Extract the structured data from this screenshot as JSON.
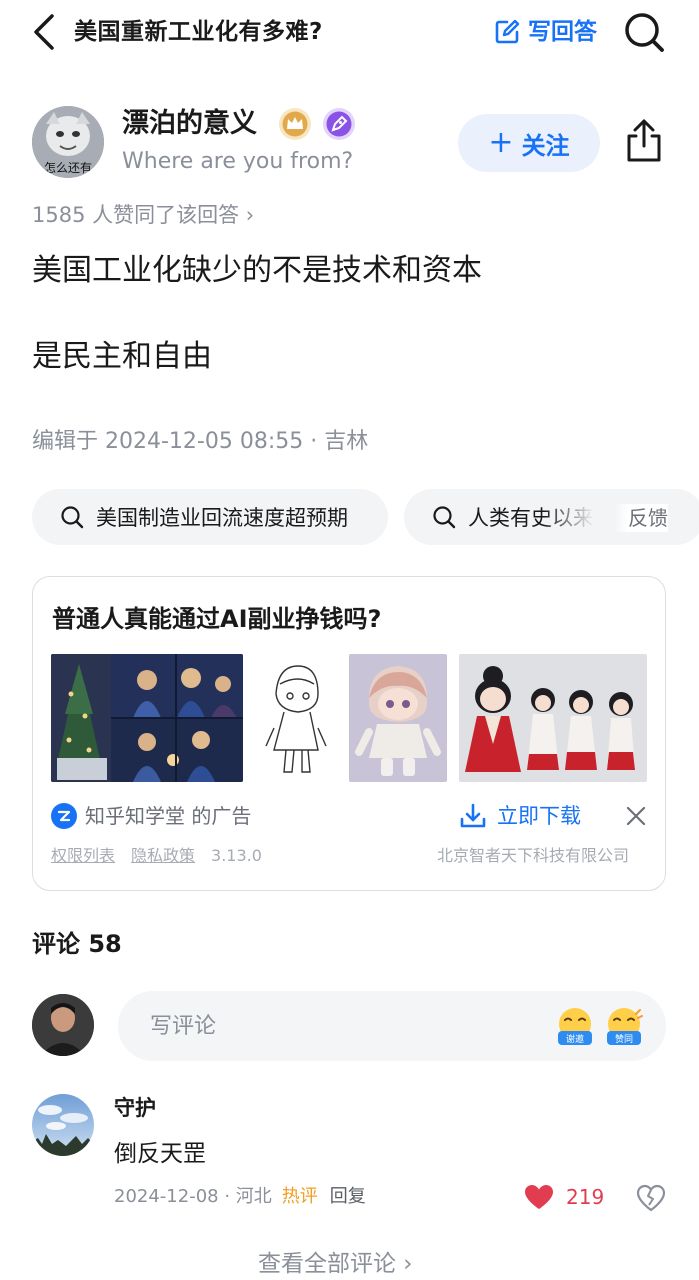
{
  "header": {
    "question_title": "美国重新工业化有多难?",
    "write_answer_label": "写回答"
  },
  "author": {
    "name": "漂泊的意义",
    "location": "Where are you from?",
    "avatar_text": "怎么还有",
    "follow_label": "关注"
  },
  "answer": {
    "agree_count_text": "1585 人赞同了该回答 ›",
    "paragraphs": [
      "美国工业化缺少的不是技术和资本",
      "是民主和自由"
    ],
    "edited_text": "编辑于 2024-12-05 08:55 · 吉林"
  },
  "related_searches": [
    {
      "label": "美国制造业回流速度超预期"
    },
    {
      "label": "人类有史以来"
    }
  ],
  "feedback_label": "反馈",
  "ad": {
    "title": "普通人真能通过AI副业挣钱吗?",
    "source": "知乎知学堂 的广告",
    "download_label": "立即下载",
    "permissions_label": "权限列表",
    "privacy_label": "隐私政策",
    "version": "3.13.0",
    "company": "北京智者天下科技有限公司"
  },
  "comments": {
    "title": "评论 58",
    "input_placeholder": "写评论",
    "emoji_labels": [
      "谢邀",
      "赞同"
    ],
    "items": [
      {
        "user": "守护",
        "text": "倒反天罡",
        "date_location": "2024-12-08 · 河北",
        "hot_tag": "热评",
        "reply_label": "回复",
        "likes": "219"
      }
    ],
    "view_all_label": "查看全部评论 ›"
  },
  "colors": {
    "brand_blue": "#1772f6",
    "like_red": "#e23c50",
    "hot_orange": "#f0a020",
    "muted_text": "#8a8f99"
  },
  "icons": {
    "back": "chevron-left-icon",
    "write": "edit-icon",
    "search": "search-icon",
    "share": "share-icon",
    "download": "download-icon",
    "close": "close-icon",
    "like": "heart-icon",
    "dislike": "broken-heart-icon"
  }
}
